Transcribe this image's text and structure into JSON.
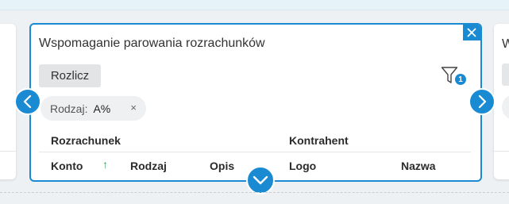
{
  "card": {
    "title": "Wspomaganie parowania rozrachunków",
    "action_button": "Rozlicz",
    "filter_badge": "1",
    "filter_chip": {
      "label": "Rodzaj:",
      "value": "A%",
      "remove": "×"
    },
    "group_headers": [
      "Rozrachunek",
      "Kontrahent"
    ],
    "columns": [
      "Konto",
      "Rodzaj",
      "Opis",
      "Logo",
      "Nazwa"
    ],
    "sort_indicator": "↑"
  },
  "right_peek": {
    "title": "W"
  },
  "colors": {
    "accent": "#1a8bd2",
    "sort_arrow": "#3aa05a"
  },
  "icons": {
    "close": "close-icon",
    "filter": "filter-icon",
    "prev": "chevron-left-icon",
    "next": "chevron-right-icon",
    "expand": "chevron-down-icon"
  }
}
